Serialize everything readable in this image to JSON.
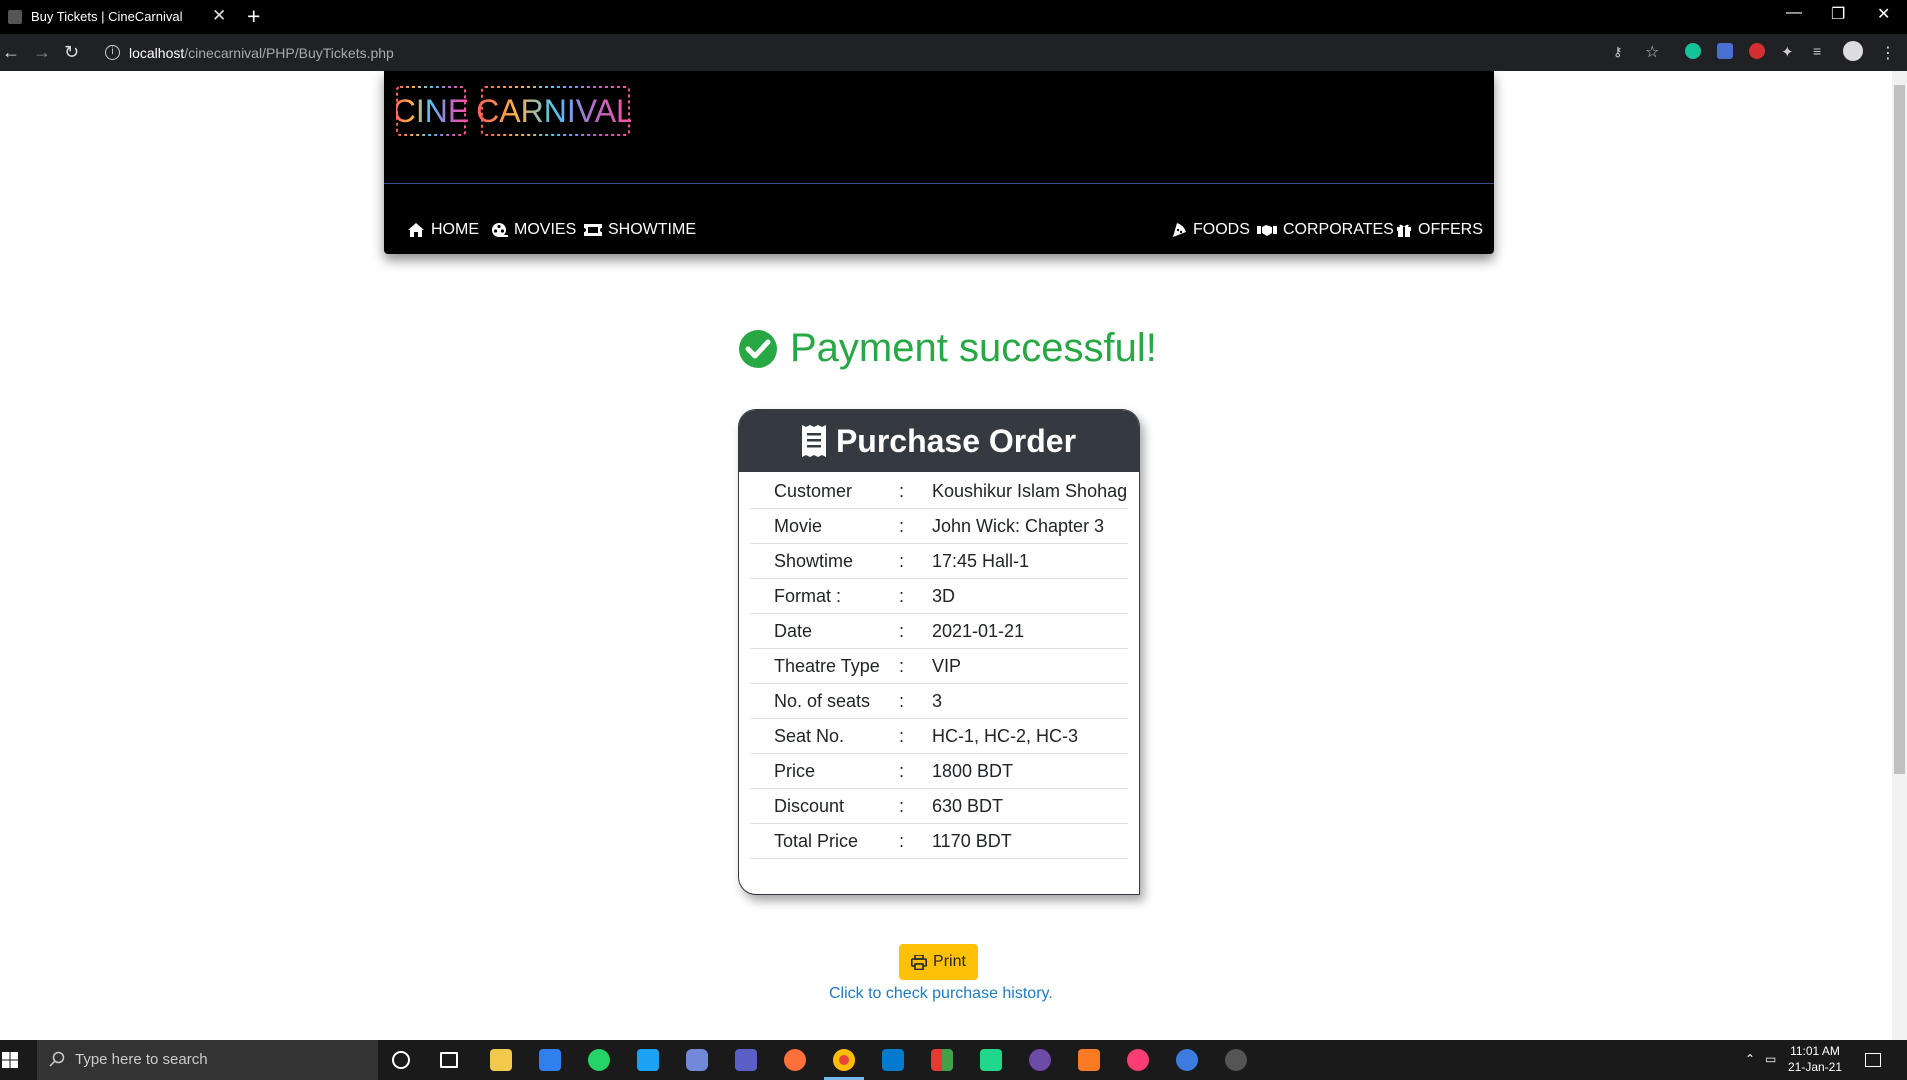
{
  "browser": {
    "tab_title": "Buy Tickets | CineCarnival",
    "url_host": "localhost",
    "url_path": "/cinecarnival/PHP/BuyTickets.php"
  },
  "site": {
    "logo_text": "CINE CARNIVAL",
    "nav_left": [
      {
        "label": "HOME",
        "icon": "home-icon"
      },
      {
        "label": "MOVIES",
        "icon": "film-reel-icon"
      },
      {
        "label": "SHOWTIME",
        "icon": "ticket-icon"
      }
    ],
    "nav_right": [
      {
        "label": "FOODS",
        "icon": "pizza-icon"
      },
      {
        "label": "CORPORATES",
        "icon": "handshake-icon"
      },
      {
        "label": "OFFERS",
        "icon": "gift-icon"
      }
    ]
  },
  "main": {
    "success_message": "Payment successful!",
    "card_title": "Purchase Order",
    "rows": [
      {
        "label": "Customer",
        "sep": ":",
        "value": "Koushikur Islam Shohag"
      },
      {
        "label": "Movie",
        "sep": ":",
        "value": "John Wick: Chapter 3"
      },
      {
        "label": "Showtime",
        "sep": ":",
        "value": "17:45 Hall-1"
      },
      {
        "label": "Format :",
        "sep": ":",
        "value": "3D"
      },
      {
        "label": "Date",
        "sep": ":",
        "value": "2021-01-21"
      },
      {
        "label": "Theatre Type",
        "sep": ":",
        "value": "VIP"
      },
      {
        "label": "No. of seats",
        "sep": ":",
        "value": "3"
      },
      {
        "label": "Seat No.",
        "sep": ":",
        "value": "HC-1, HC-2, HC-3"
      },
      {
        "label": "Price",
        "sep": ":",
        "value": "1800 BDT"
      },
      {
        "label": "Discount",
        "sep": ":",
        "value": "630 BDT"
      },
      {
        "label": "Total Price",
        "sep": ":",
        "value": "1170 BDT"
      }
    ],
    "print_label": "Print",
    "history_link": "Click to check purchase history."
  },
  "taskbar": {
    "search_placeholder": "Type here to search",
    "time": "11:01 AM",
    "date": "21-Jan-21"
  },
  "colors": {
    "success": "#28a745",
    "card_header": "#343a40",
    "print_button": "#ffc107",
    "link": "#1e7bc3"
  }
}
